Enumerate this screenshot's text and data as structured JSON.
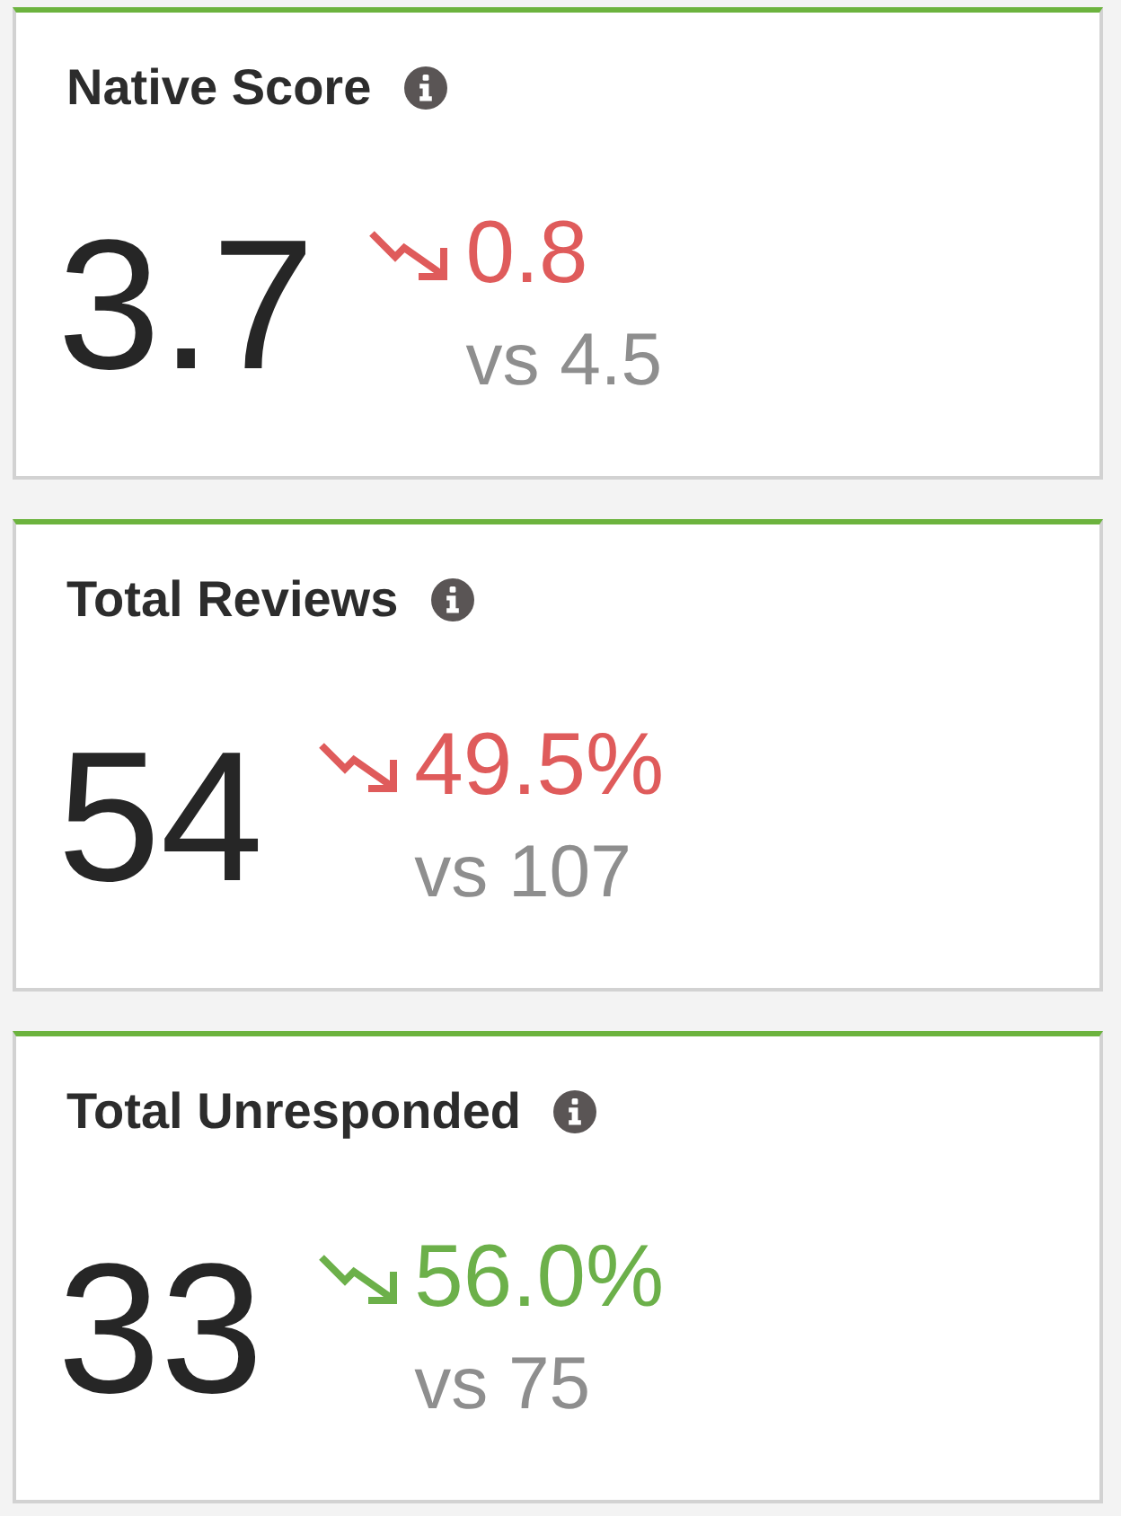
{
  "cards": [
    {
      "title": "Native Score",
      "value": "3.7",
      "falling": true,
      "change": "0.8",
      "color": "#df5b5b",
      "comparison": "vs 4.5"
    },
    {
      "title": "Total Reviews",
      "value": "54",
      "falling": true,
      "change": "49.5%",
      "color": "#df5b5b",
      "comparison": "vs 107"
    },
    {
      "title": "Total Unresponded",
      "value": "33",
      "falling": true,
      "change": "56.0%",
      "color": "#6cb04a",
      "comparison": "vs 75"
    }
  ]
}
